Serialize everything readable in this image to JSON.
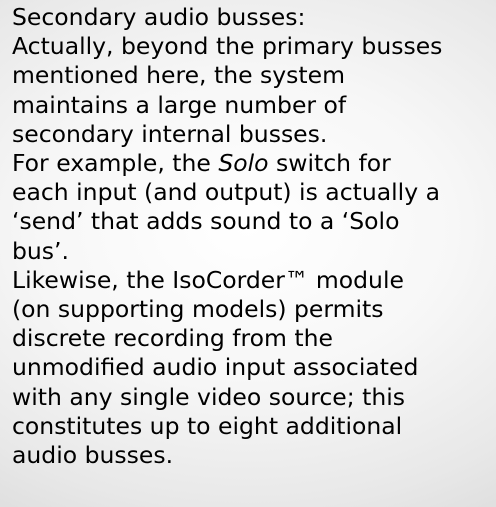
{
  "note": {
    "heading": "Secondary audio busses:",
    "lines": [
      "Actually, beyond the primary busses",
      "mentioned here, the system",
      "maintains a large number of",
      "secondary internal busses.",
      {
        "before": "For example, the ",
        "em": "Solo",
        "after": " switch for"
      },
      "each input (and output) is actually a",
      "‘send’ that adds sound to a ‘Solo",
      "bus’.",
      "Likewise, the IsoCorder™ module",
      "(on supporting models) permits",
      "discrete recording from the",
      "unmodified audio input associated",
      "with any single video source; this",
      "constitutes up to eight additional",
      "audio busses."
    ]
  }
}
